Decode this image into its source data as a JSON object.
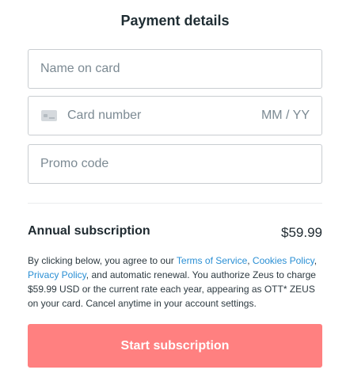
{
  "header": {
    "title": "Payment details"
  },
  "form": {
    "name_placeholder": "Name on card",
    "card_icon": "credit-card-icon",
    "card_number_placeholder": "Card number",
    "expiry_placeholder": "MM / YY",
    "promo_placeholder": "Promo code"
  },
  "subscription": {
    "label": "Annual subscription",
    "price": "$59.99"
  },
  "legal": {
    "part1": "By clicking below, you agree to our ",
    "terms_link": "Terms of Service",
    "sep1": ", ",
    "cookies_link": "Cookies Policy",
    "sep2": ", ",
    "privacy_link": "Privacy Policy",
    "part2": ", and automatic renewal. You authorize Zeus to charge $59.99 USD or the current rate each year, appearing as OTT* ZEUS on your card. Cancel anytime in your account settings."
  },
  "cta": {
    "label": "Start subscription"
  },
  "colors": {
    "cta_background": "#ff8080",
    "link": "#2a8fd4",
    "field_border": "#c9cdd1"
  }
}
